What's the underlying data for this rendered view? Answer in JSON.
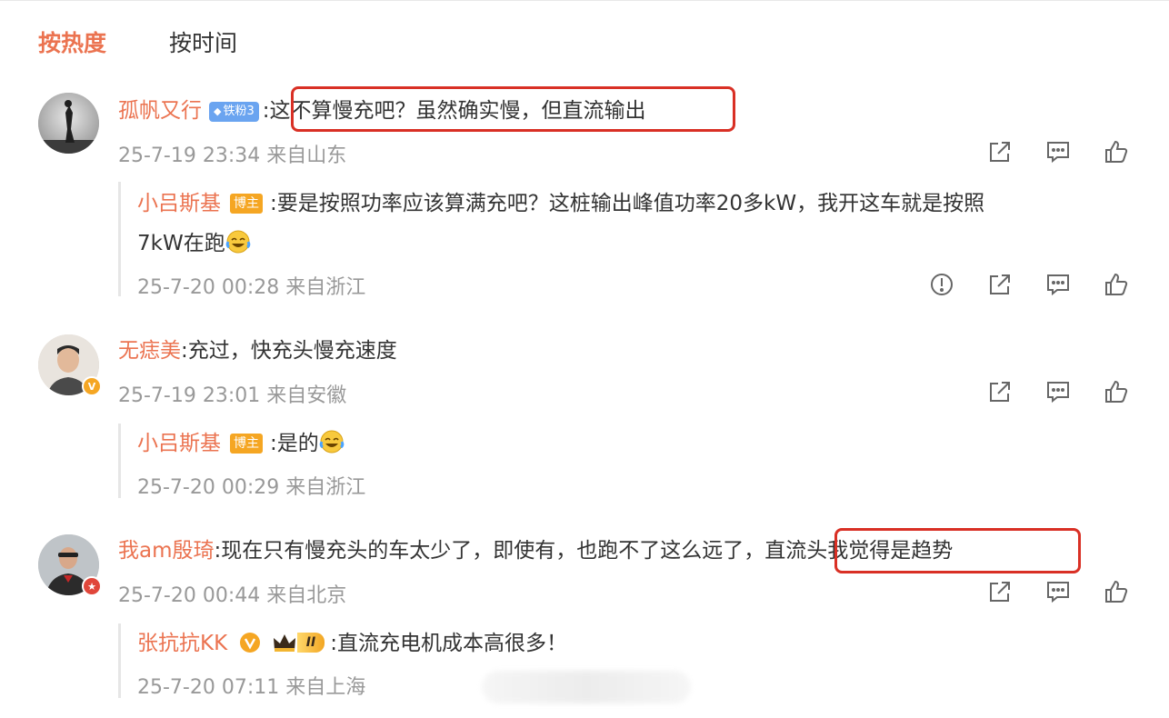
{
  "tabs": [
    {
      "label": "按热度",
      "active": true
    },
    {
      "label": "按时间",
      "active": false
    }
  ],
  "comments": [
    {
      "username": "孤帆又行",
      "fan_badge": "铁粉3",
      "text": ":这不算慢充吧？虽然确实慢，但直流输出",
      "time": "25-7-19 23:34",
      "location": "来自山东",
      "reply": {
        "username": "小吕斯基",
        "badge": "博主",
        "text_line1": ":要是按照功率应该算满充吧？这桩输出峰值功率20多kW，我开这车就是按照",
        "text_line2": "7kW在跑",
        "emoji": "laugh-cry-emoji",
        "time": "25-7-20 00:28",
        "location": "来自浙江"
      }
    },
    {
      "username": "无痣美",
      "text": ":充过，快充头慢充速度",
      "time": "25-7-19 23:01",
      "location": "来自安徽",
      "verified_badge_color": "#f5a623",
      "reply": {
        "username": "小吕斯基",
        "badge": "博主",
        "text": ":是的",
        "emoji": "laugh-cry-emoji",
        "time": "25-7-20 00:29",
        "location": "来自浙江"
      }
    },
    {
      "username": "我am殷琦",
      "text_plain": ":现在只有慢充头的车太少了，即使有，也跑不了这么远了，",
      "text_highlight": "直流头我觉得是趋势",
      "time": "25-7-20 00:44",
      "location": "来自北京",
      "reply": {
        "username": "张抗抗KK",
        "vip_level": "II",
        "text": ":直流充电机成本高很多！",
        "time": "25-7-20 07:11",
        "location": "来自上海"
      }
    }
  ],
  "colors": {
    "accent": "#eb7350",
    "highlight_box": "#d93025",
    "meta_text": "#999999"
  },
  "icons": [
    "report-icon",
    "share-icon",
    "comment-icon",
    "like-icon"
  ]
}
